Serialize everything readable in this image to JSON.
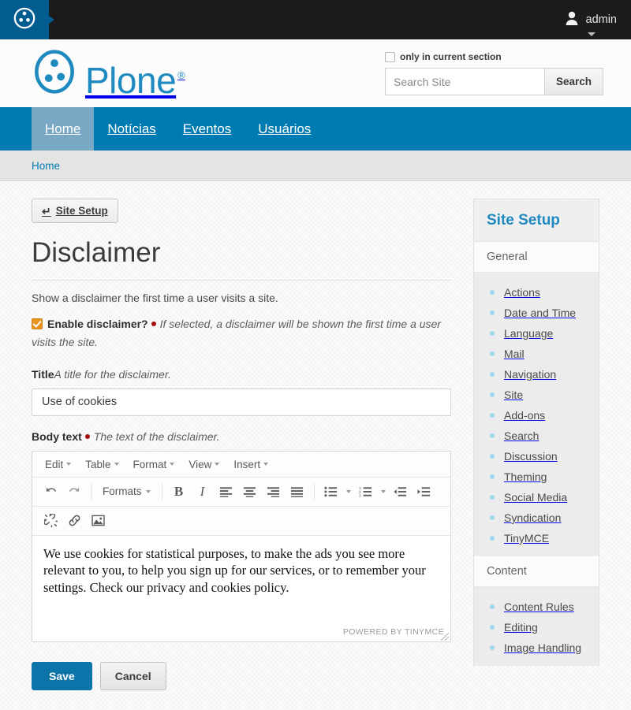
{
  "toolbar": {
    "logo_icon": "plone-logo-icon",
    "user_icon": "user-avatar-icon",
    "username": "admin",
    "caret_icon": "chevron-down-icon"
  },
  "header": {
    "brand_name": "Plone",
    "brand_registered": "®",
    "only_current_section_label": "only in current section",
    "search_placeholder": "Search Site",
    "search_value": "",
    "search_button": "Search"
  },
  "nav": {
    "items": [
      {
        "label": "Home",
        "active": true
      },
      {
        "label": "Notícias",
        "active": false
      },
      {
        "label": "Eventos",
        "active": false
      },
      {
        "label": "Usuários",
        "active": false
      }
    ]
  },
  "breadcrumb": {
    "items": [
      "Home"
    ]
  },
  "main": {
    "back_button": {
      "icon": "return-arrow-icon",
      "arrow": "↵",
      "label": "Site Setup"
    },
    "title": "Disclaimer",
    "lead": "Show a disclaimer the first time a user visits a site.",
    "enable_field": {
      "checked": true,
      "label": "Enable disclaimer?",
      "hint": "If selected, a disclaimer will be shown the first time a user visits the site."
    },
    "title_field": {
      "label": "Title",
      "hint": "A title for the disclaimer.",
      "value": "Use of cookies",
      "placeholder": ""
    },
    "body_field": {
      "label": "Body text",
      "hint": "The text of the disclaimer."
    },
    "editor": {
      "menubar": [
        "Edit",
        "Table",
        "Format",
        "View",
        "Insert"
      ],
      "toolbar_row1": [
        {
          "name": "undo-icon",
          "glyph": "↶",
          "type": "icon"
        },
        {
          "name": "redo-icon",
          "glyph": "↷",
          "type": "icon"
        },
        {
          "name": "formats-dropdown",
          "label": "Formats",
          "type": "text"
        },
        {
          "name": "bold-icon",
          "glyph": "B",
          "type": "icon"
        },
        {
          "name": "italic-icon",
          "glyph": "I",
          "type": "icon"
        },
        {
          "name": "align-left-icon",
          "type": "icon"
        },
        {
          "name": "align-center-icon",
          "type": "icon"
        },
        {
          "name": "align-right-icon",
          "type": "icon"
        },
        {
          "name": "align-justify-icon",
          "type": "icon"
        },
        {
          "name": "bullet-list-icon",
          "type": "icon"
        },
        {
          "name": "numbered-list-icon",
          "type": "icon"
        },
        {
          "name": "outdent-icon",
          "type": "icon"
        },
        {
          "name": "indent-icon",
          "type": "icon"
        }
      ],
      "toolbar_row2": [
        {
          "name": "unlink-icon",
          "type": "icon"
        },
        {
          "name": "link-icon",
          "type": "icon"
        },
        {
          "name": "image-icon",
          "type": "icon"
        }
      ],
      "content": "We use cookies for statistical purposes, to make the ads you see more relevant to you, to help you sign up for our services, or to remember your settings. Check our privacy and cookies policy.",
      "status_text": "POWERED BY TINYMCE"
    },
    "actions": {
      "save": "Save",
      "cancel": "Cancel"
    }
  },
  "sidebar": {
    "title": "Site Setup",
    "sections": [
      {
        "heading": "General",
        "items": [
          "Actions",
          "Date and Time",
          "Language",
          "Mail",
          "Navigation",
          "Site",
          "Add-ons",
          "Search",
          "Discussion",
          "Theming",
          "Social Media",
          "Syndication",
          "TinyMCE"
        ]
      },
      {
        "heading": "Content",
        "items": [
          "Content Rules",
          "Editing",
          "Image Handling"
        ]
      }
    ]
  },
  "colors": {
    "brand_blue": "#1f8ac0",
    "nav_blue": "#007bb1",
    "toolbar_dark": "#1b1b1b",
    "logo_tile": "#035c8f",
    "accent_orange": "#e8921f",
    "required_red": "#a30d0d",
    "save_blue": "#0b74a8",
    "sidebar_dot": "#9fd6ec"
  }
}
